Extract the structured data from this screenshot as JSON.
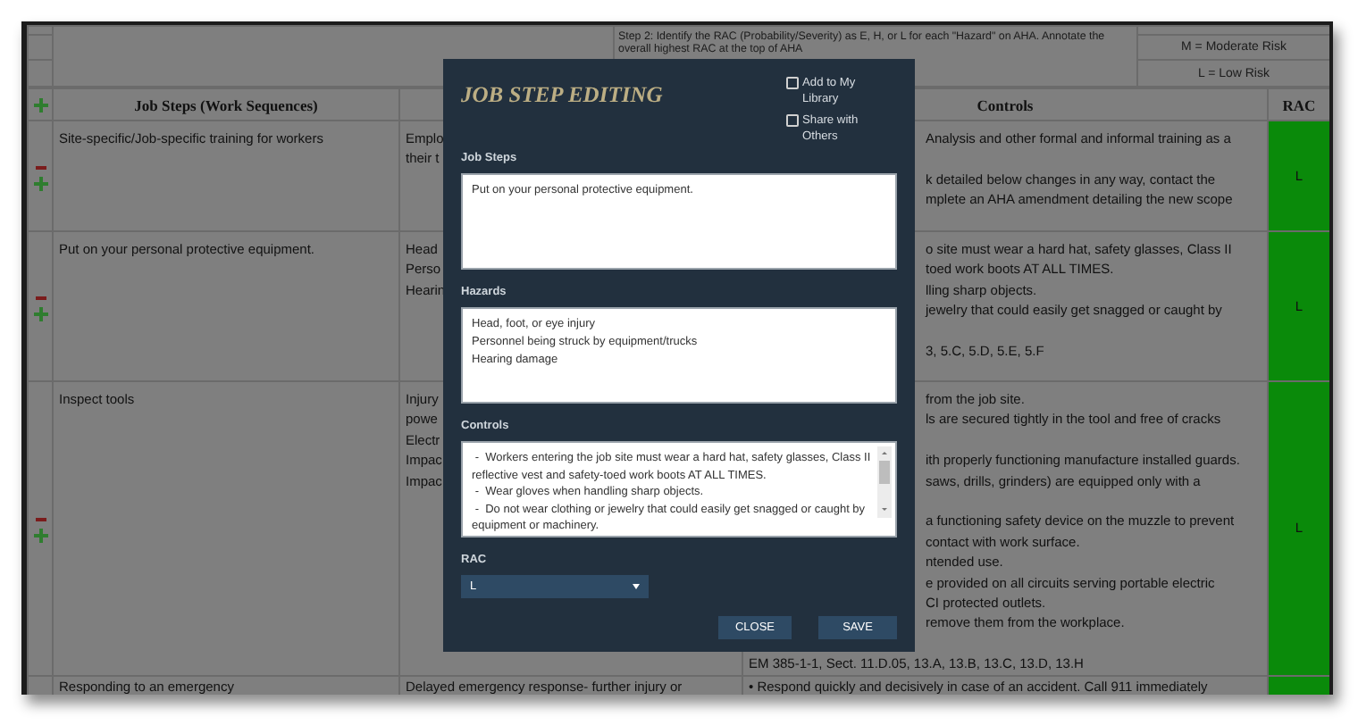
{
  "instructions": {
    "text": "Step 2:  Identify the RAC (Probability/Severity) as E, H, or L for each \"Hazard\" on AHA.  Annotate the overall highest RAC at the top of AHA",
    "legend": [
      "M = Moderate Risk",
      "L = Low Risk"
    ]
  },
  "table": {
    "columns": {
      "job_steps": "Job Steps (Work Sequences)",
      "controls": "Controls",
      "rac": "RAC"
    },
    "rows": [
      {
        "job_step": "Site-specific/Job-specific training for workers",
        "hazards": [
          "Emplo",
          "their t"
        ],
        "controls": [
          {
            "kind": "covered",
            "lines": [
              "Analysis and other formal and informal training as a"
            ]
          },
          {
            "kind": "covered",
            "lines": [
              "k detailed below changes in any way, contact the",
              "mplete an AHA amendment detailing the new scope"
            ]
          }
        ],
        "rac": "L"
      },
      {
        "job_step": "Put on your personal protective equipment.",
        "hazards": [
          "Head",
          "Perso",
          "Hearin"
        ],
        "controls": [
          {
            "kind": "covered",
            "lines": [
              "o site must wear a hard hat, safety glasses, Class II",
              "toed work boots AT ALL TIMES.",
              "lling sharp objects.",
              "jewelry that could easily get snagged or caught by"
            ]
          },
          {
            "kind": "covered",
            "lines": [
              "3, 5.C, 5.D, 5.E, 5.F"
            ]
          }
        ],
        "rac": "L"
      },
      {
        "job_step": "Inspect tools",
        "hazards": [
          "Injury",
          "powe",
          "Electr",
          "Impac",
          "Impac"
        ],
        "controls": [
          {
            "kind": "covered",
            "lines": [
              "from the job site.",
              "ls are secured tightly in the tool and free of cracks"
            ]
          },
          {
            "kind": "covered",
            "lines": [
              "ith properly functioning manufacture installed guards.",
              "saws, drills, grinders) are equipped only with a"
            ]
          },
          {
            "kind": "covered",
            "lines": [
              "a functioning safety device on the muzzle to prevent",
              "contact with work surface.",
              "ntended use.",
              "e provided on all circuits serving portable electric",
              "CI protected outlets.",
              "remove them from the workplace."
            ]
          },
          {
            "kind": "full",
            "lines": [
              "EM 385-1-1, Sect. 11.D.05, 13.A, 13.B, 13.C, 13.D, 13.H"
            ]
          }
        ],
        "rac": "L"
      },
      {
        "job_step": "Responding to an emergency",
        "hazards": [
          "Delayed emergency response- further injury or"
        ],
        "controls": [
          {
            "kind": "full",
            "lines": [
              "•  Respond quickly and decisively in case of an accident.  Call 911 immediately"
            ]
          }
        ],
        "rac": ""
      }
    ]
  },
  "dialog": {
    "title": "JOB STEP EDITING",
    "options": [
      {
        "label": "Add to My Library",
        "checked": false
      },
      {
        "label": "Share with Others",
        "checked": false
      }
    ],
    "fields": [
      {
        "label": "Job Steps",
        "kind": "plain",
        "value": "Put on your personal protective equipment."
      },
      {
        "label": "Hazards",
        "kind": "plain",
        "value": "Head, foot, or eye injury\nPersonnel being struck by equipment/trucks\nHearing damage"
      },
      {
        "label": "Controls",
        "kind": "scrolling",
        "value": " -  Workers entering the job site must wear a hard hat, safety glasses, Class II reflective vest and safety-toed work boots AT ALL TIMES.\n -  Wear gloves when handling sharp objects.\n -  Do not wear clothing or jewelry that could easily get snagged or caught by equipment or machinery."
      }
    ],
    "rac": {
      "label": "RAC",
      "value": "L"
    },
    "buttons": [
      "CLOSE",
      "SAVE"
    ]
  }
}
